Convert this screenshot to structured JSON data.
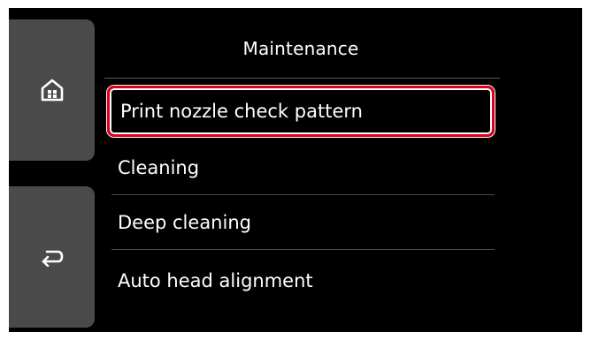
{
  "screen": {
    "title": "Maintenance",
    "home_button": {
      "icon": "home-icon"
    },
    "back_button": {
      "icon": "back-arrow-icon"
    },
    "menu_items": [
      {
        "label": "Print nozzle check pattern",
        "selected": true
      },
      {
        "label": "Cleaning",
        "selected": false
      },
      {
        "label": "Deep cleaning",
        "selected": false
      },
      {
        "label": "Auto head alignment",
        "selected": false
      }
    ]
  },
  "colors": {
    "background": "#000000",
    "side_button": "#4a4a4a",
    "highlight_border": "#e0001a",
    "text": "#ffffff"
  }
}
